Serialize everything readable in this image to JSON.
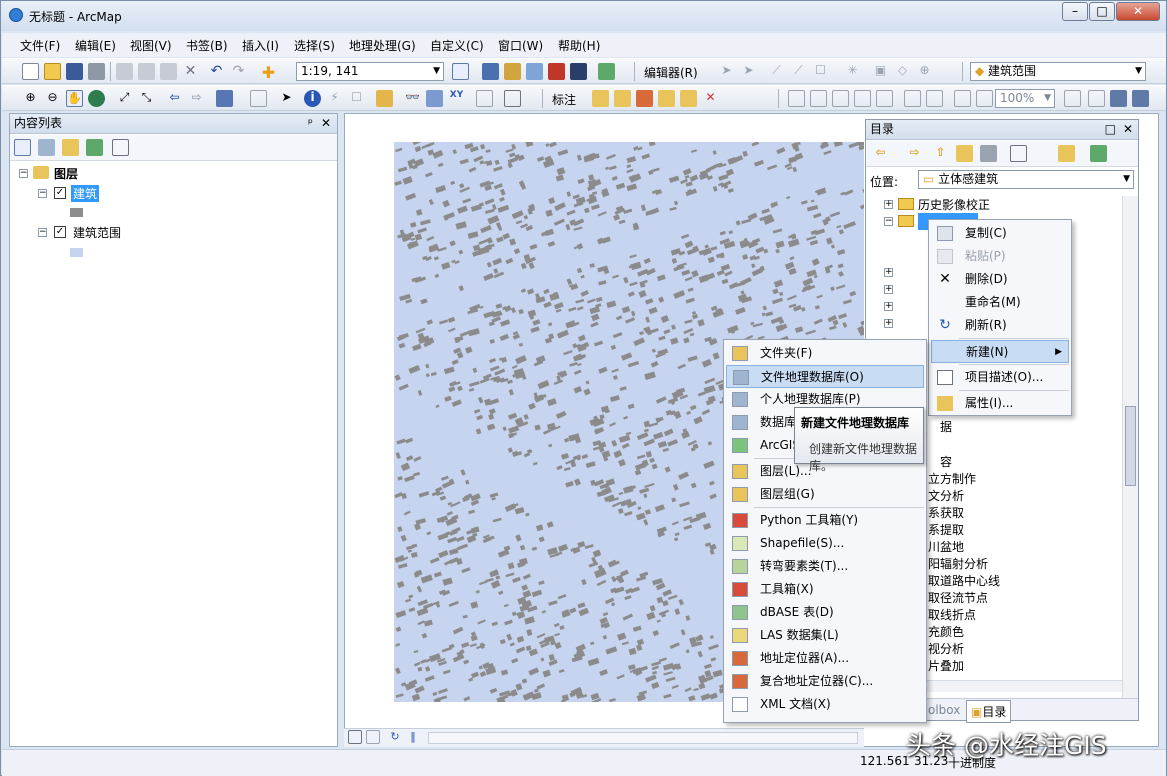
{
  "window": {
    "title": "无标题 - ArcMap",
    "min": "–",
    "max": "□",
    "close": "✕"
  },
  "menu": [
    "文件(F)",
    "编辑(E)",
    "视图(V)",
    "书签(B)",
    "插入(I)",
    "选择(S)",
    "地理处理(G)",
    "自定义(C)",
    "窗口(W)",
    "帮助(H)"
  ],
  "toolbar": {
    "scale": "1:19, 141",
    "editor": "编辑器(R)",
    "target_layer": "建筑范围",
    "label_btn": "标注",
    "zoom": "100%"
  },
  "toc": {
    "title": "内容列表",
    "pin": "ᵖ",
    "close": "✕",
    "root": "图层",
    "layers": [
      {
        "name": "建筑",
        "checked": "✓",
        "swatch": "#8d8d8d"
      },
      {
        "name": "建筑范围",
        "checked": "✓",
        "swatch": "#c5d3ee"
      }
    ]
  },
  "catalog": {
    "title": "目录",
    "location_label": "位置:",
    "location_value": "立体感建筑",
    "tree": [
      "历史影像校正",
      "立体感建筑"
    ],
    "partial_items": [
      "据",
      "容",
      "立方制作",
      "文分析",
      "系获取",
      "系提取",
      "川盆地",
      "阳辐射分析",
      "取道路中心线",
      "取径流节点",
      "取线折点",
      "充颜色",
      "视分析",
      "片叠加"
    ],
    "tabs": [
      "olbox",
      "目录"
    ]
  },
  "context_menu": {
    "items": [
      {
        "label": "复制(C)",
        "icon": "copy-icon",
        "disabled": false
      },
      {
        "label": "粘贴(P)",
        "icon": "paste-icon",
        "disabled": true
      },
      {
        "label": "删除(D)",
        "icon": "delete-icon",
        "disabled": false
      },
      {
        "label": "重命名(M)",
        "icon": "",
        "disabled": false
      },
      {
        "label": "刷新(R)",
        "icon": "refresh-icon",
        "disabled": false
      },
      {
        "label": "新建(N)",
        "icon": "",
        "disabled": false,
        "submenu": "▶"
      },
      {
        "label": "项目描述(O)...",
        "icon": "description-icon",
        "disabled": false
      },
      {
        "label": "属性(I)...",
        "icon": "properties-icon",
        "disabled": false
      }
    ]
  },
  "new_submenu": {
    "items": [
      {
        "label": "文件夹(F)",
        "color": "#e9c45a"
      },
      {
        "label": "文件地理数据库(O)",
        "color": "#9eb4cf"
      },
      {
        "label": "个人地理数据库(P)",
        "color": "#9eb4cf"
      },
      {
        "label": "数据库",
        "color": "#9eb4cf"
      },
      {
        "label": "ArcGIS",
        "color": "#7cc47b"
      },
      {
        "label": "图层(L)...",
        "color": "#e9c45a"
      },
      {
        "label": "图层组(G)",
        "color": "#e9c45a"
      },
      {
        "label": "Python 工具箱(Y)",
        "color": "#d84b3a"
      },
      {
        "label": "Shapefile(S)...",
        "color": "#d9e8b5"
      },
      {
        "label": "转弯要素类(T)...",
        "color": "#b8d49a"
      },
      {
        "label": "工具箱(X)",
        "color": "#d84b3a"
      },
      {
        "label": "dBASE 表(D)",
        "color": "#8fc48e"
      },
      {
        "label": "LAS 数据集(L)",
        "color": "#e9d77a"
      },
      {
        "label": "地址定位器(A)...",
        "color": "#d86a3a"
      },
      {
        "label": "复合地址定位器(C)...",
        "color": "#d86a3a"
      },
      {
        "label": "XML 文档(X)",
        "color": "#ffffff"
      }
    ]
  },
  "tooltip": {
    "title": "新建文件地理数据库",
    "desc": "创建新文件地理数据库。"
  },
  "status": {
    "x": "121.561",
    "y": "31.23",
    "units": "十进制度"
  },
  "watermark": "头条 @水经注GIS",
  "colors": {
    "map_bg": "#c6d4ef",
    "buildings": "#8b8b8b"
  }
}
